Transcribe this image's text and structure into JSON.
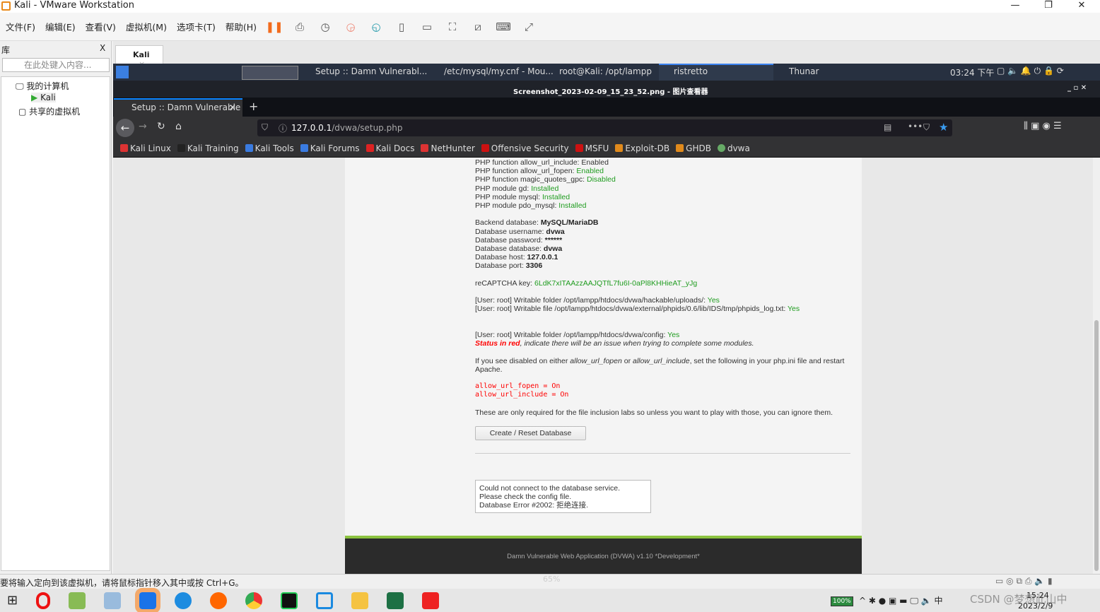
{
  "window": {
    "title": "Kali - VMware Workstation"
  },
  "menu": [
    "文件(F)",
    "编辑(E)",
    "查看(V)",
    "虚拟机(M)",
    "选项卡(T)",
    "帮助(H)"
  ],
  "library": {
    "title": "库",
    "close": "X",
    "search_placeholder": "在此处键入内容...",
    "tree": [
      "我的计算机",
      "Kali",
      "共享的虚拟机"
    ]
  },
  "vm_tab": {
    "label": "Kali",
    "close": "×"
  },
  "xfce": {
    "tasks": [
      "Setup :: Damn Vulnerabl...",
      "/etc/mysql/my.cnf - Mou...",
      "root@Kali: /opt/lampp",
      "ristretto",
      "Thunar"
    ],
    "clock": "03:24 下午"
  },
  "ristretto": {
    "title": "Screenshot_2023-02-09_15_23_52.png - 图片查看器"
  },
  "firefox": {
    "tab_title": "Setup :: Damn Vulnerable",
    "url_host": "127.0.0.1",
    "url_path": "/dvwa/setup.php",
    "bookmarks": [
      {
        "label": "Kali Linux",
        "color": "#d33"
      },
      {
        "label": "Kali Training",
        "color": "#222"
      },
      {
        "label": "Kali Tools",
        "color": "#3a7be0"
      },
      {
        "label": "Kali Forums",
        "color": "#3a7be0"
      },
      {
        "label": "Kali Docs",
        "color": "#d22"
      },
      {
        "label": "NetHunter",
        "color": "#d33"
      },
      {
        "label": "Offensive Security",
        "color": "#c11"
      },
      {
        "label": "MSFU",
        "color": "#c11"
      },
      {
        "label": "Exploit-DB",
        "color": "#e08a1c"
      },
      {
        "label": "GHDB",
        "color": "#e08a1c"
      },
      {
        "label": "dvwa",
        "color": "#6a6"
      }
    ]
  },
  "page": {
    "cut_line": "PHP function allow_url_include: Enabled",
    "checks": [
      [
        "PHP function allow_url_fopen: ",
        "Enabled"
      ],
      [
        "PHP function magic_quotes_gpc: ",
        "Disabled"
      ],
      [
        "PHP module gd: ",
        "Installed"
      ],
      [
        "PHP module mysql: ",
        "Installed"
      ],
      [
        "PHP module pdo_mysql: ",
        "Installed"
      ]
    ],
    "db": [
      [
        "Backend database: ",
        "MySQL/MariaDB"
      ],
      [
        "Database username: ",
        "dvwa"
      ],
      [
        "Database password: ",
        "******"
      ],
      [
        "Database database: ",
        "dvwa"
      ],
      [
        "Database host: ",
        "127.0.0.1"
      ],
      [
        "Database port: ",
        "3306"
      ]
    ],
    "recaptcha_label": "reCAPTCHA key: ",
    "recaptcha_value": "6LdK7xITAAzzAAJQTfL7fu6I-0aPl8KHHieAT_yJg",
    "writable": [
      [
        "[User: root] Writable folder /opt/lampp/htdocs/dvwa/hackable/uploads/: ",
        "Yes"
      ],
      [
        "[User: root] Writable file /opt/lampp/htdocs/dvwa/external/phpids/0.6/lib/IDS/tmp/phpids_log.txt: ",
        "Yes"
      ],
      [
        "[User: root] Writable folder /opt/lampp/htdocs/dvwa/config: ",
        "Yes"
      ]
    ],
    "status_red": "Status in red",
    "status_rest": ", indicate there will be an issue when trying to complete some modules.",
    "if_1": "If you see disabled on either ",
    "if_fopen": "allow_url_fopen",
    "if_or": " or ",
    "if_include": "allow_url_include",
    "if_2": ", set the following in your php.ini file and restart Apache.",
    "code": [
      "allow_url_fopen = On",
      "allow_url_include = On"
    ],
    "only_required": "These are only required for the file inclusion labs so unless you want to play with those, you can ignore them.",
    "button": "Create / Reset Database",
    "error": [
      "Could not connect to the database service.",
      "Please check the config file.",
      "Database Error #2002: 拒绝连接."
    ],
    "footer": "Damn Vulnerable Web Application (DVWA) v1.10 *Development*"
  },
  "statusbar": "要将输入定向到该虚拟机，请将鼠标指针移入其中或按 Ctrl+G。",
  "taskbar": {
    "battery": "100%",
    "watermark": "CSDN @梦想此山中",
    "date": "2023/2/9",
    "time": "15:24",
    "zoom_overlay": "65%"
  }
}
